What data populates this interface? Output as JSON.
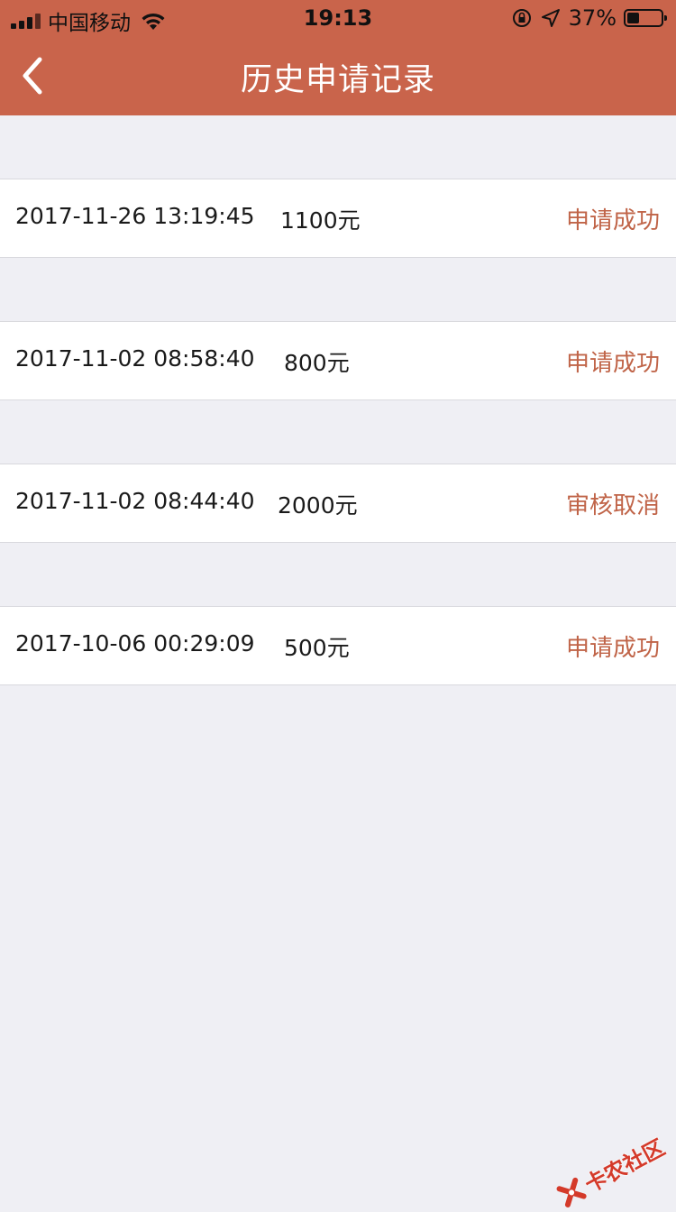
{
  "status_bar": {
    "carrier": "中国移动",
    "time": "19:13",
    "battery_percent": "37%",
    "battery_level": 0.37
  },
  "navbar": {
    "title": "历史申请记录",
    "back_icon": "chevron-left-icon"
  },
  "records": [
    {
      "time": "2017-11-26 13:19:45",
      "amount": "1100元",
      "status": "申请成功"
    },
    {
      "time": "2017-11-02 08:58:40",
      "amount": "800元",
      "status": "申请成功"
    },
    {
      "time": "2017-11-02 08:44:40",
      "amount": "2000元",
      "status": "审核取消"
    },
    {
      "time": "2017-10-06 00:29:09",
      "amount": "500元",
      "status": "申请成功"
    }
  ],
  "watermark": {
    "text": "卡农社区"
  },
  "colors": {
    "header": "#c9644b",
    "status_text": "#c06448",
    "background": "#efeff4"
  }
}
